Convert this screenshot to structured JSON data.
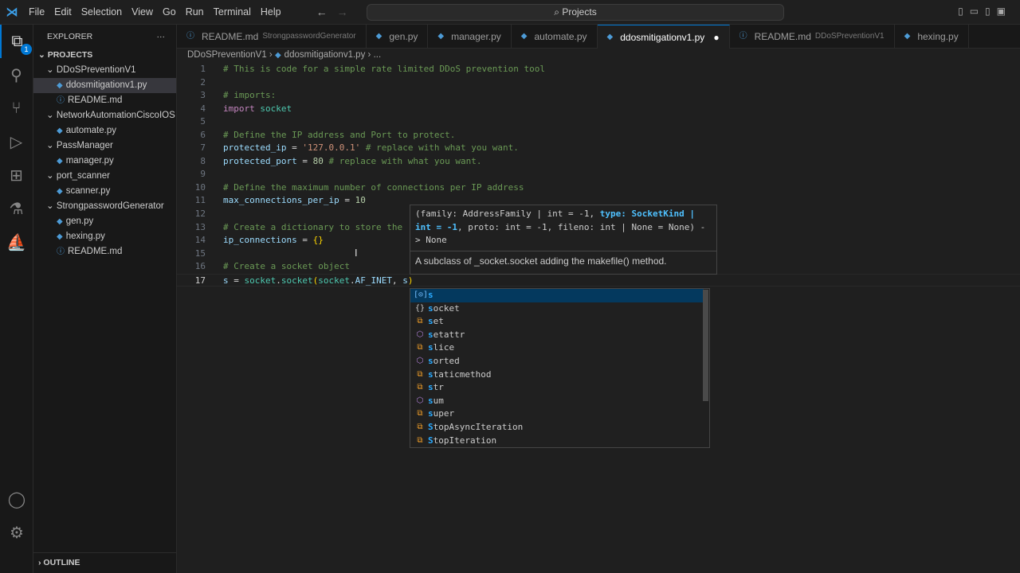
{
  "menu": [
    "File",
    "Edit",
    "Selection",
    "View",
    "Go",
    "Run",
    "Terminal",
    "Help"
  ],
  "search": "Projects",
  "sidebar": {
    "title": "EXPLORER",
    "more": "···",
    "section": "PROJECTS",
    "badge": "1",
    "items": [
      {
        "label": "DDoSPreventionV1",
        "type": "folder",
        "indent": 1
      },
      {
        "label": "ddosmitigationv1.py",
        "type": "py",
        "indent": 2,
        "selected": true
      },
      {
        "label": "README.md",
        "type": "md",
        "indent": 2
      },
      {
        "label": "NetworkAutomationCiscoIOS",
        "type": "folder",
        "indent": 1
      },
      {
        "label": "automate.py",
        "type": "py",
        "indent": 2
      },
      {
        "label": "PassManager",
        "type": "folder",
        "indent": 1
      },
      {
        "label": "manager.py",
        "type": "py",
        "indent": 2
      },
      {
        "label": "port_scanner",
        "type": "folder",
        "indent": 1
      },
      {
        "label": "scanner.py",
        "type": "py",
        "indent": 2
      },
      {
        "label": "StrongpasswordGenerator",
        "type": "folder",
        "indent": 1
      },
      {
        "label": "gen.py",
        "type": "py",
        "indent": 2
      },
      {
        "label": "hexing.py",
        "type": "py",
        "indent": 2
      },
      {
        "label": "README.md",
        "type": "md",
        "indent": 2
      }
    ],
    "outline": "OUTLINE"
  },
  "tabs": [
    {
      "label": "README.md",
      "desc": "StrongpasswordGenerator",
      "type": "md"
    },
    {
      "label": "gen.py",
      "type": "py"
    },
    {
      "label": "manager.py",
      "type": "py"
    },
    {
      "label": "automate.py",
      "type": "py"
    },
    {
      "label": "ddosmitigationv1.py",
      "type": "py",
      "active": true,
      "modified": true
    },
    {
      "label": "README.md",
      "desc": "DDoSPreventionV1",
      "type": "md"
    },
    {
      "label": "hexing.py",
      "type": "py"
    }
  ],
  "breadcrumb": [
    "DDoSPreventionV1",
    "ddosmitigationv1.py",
    "..."
  ],
  "code": [
    [
      [
        "c",
        "# This is code for a simple rate limited DDoS prevention tool"
      ]
    ],
    [],
    [
      [
        "c",
        "# imports:"
      ]
    ],
    [
      [
        "k",
        "import"
      ],
      [
        "p",
        " "
      ],
      [
        "m",
        "socket"
      ]
    ],
    [],
    [
      [
        "c",
        "# Define the IP address and Port to protect."
      ]
    ],
    [
      [
        "v",
        "protected_ip"
      ],
      [
        "p",
        " = "
      ],
      [
        "s",
        "'127.0.0.1'"
      ],
      [
        "c",
        " # replace with what you want."
      ]
    ],
    [
      [
        "v",
        "protected_port"
      ],
      [
        "p",
        " = "
      ],
      [
        "n",
        "80"
      ],
      [
        "c",
        " # replace with what you want."
      ]
    ],
    [],
    [
      [
        "c",
        "# Define the maximum number of connections per IP address"
      ]
    ],
    [
      [
        "v",
        "max_connections_per_ip"
      ],
      [
        "p",
        " = "
      ],
      [
        "n",
        "10"
      ]
    ],
    [],
    [
      [
        "c",
        "# Create a dictionary to store the"
      ]
    ],
    [
      [
        "v",
        "ip_connections"
      ],
      [
        "p",
        " = "
      ],
      [
        "b",
        "{}"
      ]
    ],
    [],
    [
      [
        "c",
        "# Create a socket object"
      ]
    ],
    [
      [
        "v",
        "s"
      ],
      [
        "p",
        " = "
      ],
      [
        "m",
        "socket"
      ],
      [
        "p",
        "."
      ],
      [
        "m",
        "socket"
      ],
      [
        "b",
        "("
      ],
      [
        "m",
        "socket"
      ],
      [
        "p",
        "."
      ],
      [
        "v",
        "AF_INET"
      ],
      [
        "p",
        ", "
      ],
      [
        "v",
        "s"
      ],
      [
        "b",
        ")"
      ]
    ]
  ],
  "current_line": 17,
  "hover": {
    "sig_line1": [
      "(family: AddressFamily | int = -1, ",
      "type: SocketKind |"
    ],
    "sig_line2": [
      "int = -1",
      ", proto: int = -1, fileno: int | None = None) -"
    ],
    "sig_line3": "> None",
    "doc": "A subclass of _socket.socket adding the makefile() method."
  },
  "suggestions": [
    {
      "label": "s",
      "kind": "var",
      "icon": "[⊙]",
      "selected": true
    },
    {
      "label": "socket",
      "kind": "mod",
      "icon": "{}"
    },
    {
      "label": "set",
      "kind": "cls",
      "icon": "⧉"
    },
    {
      "label": "setattr",
      "kind": "fn",
      "icon": "⬡"
    },
    {
      "label": "slice",
      "kind": "cls",
      "icon": "⧉"
    },
    {
      "label": "sorted",
      "kind": "fn",
      "icon": "⬡"
    },
    {
      "label": "staticmethod",
      "kind": "cls",
      "icon": "⧉"
    },
    {
      "label": "str",
      "kind": "cls",
      "icon": "⧉"
    },
    {
      "label": "sum",
      "kind": "fn",
      "icon": "⬡"
    },
    {
      "label": "super",
      "kind": "cls",
      "icon": "⧉"
    },
    {
      "label": "StopAsyncIteration",
      "kind": "cls",
      "icon": "⧉"
    },
    {
      "label": "StopIteration",
      "kind": "cls",
      "icon": "⧉"
    }
  ]
}
